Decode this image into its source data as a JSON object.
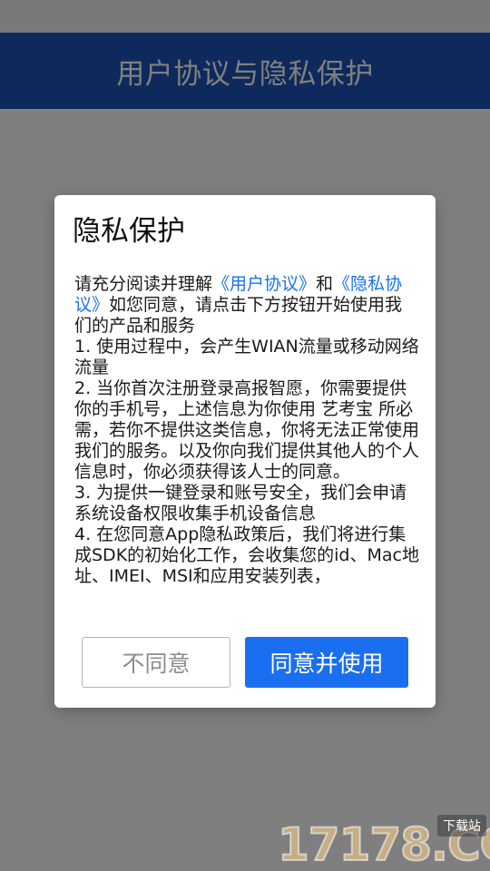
{
  "app_bar": {
    "title": "用户协议与隐私保护"
  },
  "dialog": {
    "title": "隐私保护",
    "intro_text": "请充分阅读并理解",
    "link_user_agreement": "《用户协议》",
    "intro_and": "和",
    "link_privacy_policy": "《隐私协议》",
    "intro_rest": "如您同意，请点击下方按钮开始使用我们的产品和服务",
    "items": [
      "1. 使用过程中，会产生WIAN流量或移动网络流量",
      "2. 当你首次注册登录高报智愿，你需要提供你的手机号，上述信息为你使用 艺考宝 所必需，若你不提供这类信息，你将无法正常使用我们的服务。以及你向我们提供其他人的个人信息时，你必须获得该人士的同意。",
      "3. 为提供一键登录和账号安全，我们会申请系统设备权限收集手机设备信息",
      "4. 在您同意App隐私政策后，我们将进行集成SDK的初始化工作，会收集您的id、Mac地址、IMEI、MSI和应用安装列表，"
    ],
    "disagree_label": "不同意",
    "agree_label": "同意并使用"
  },
  "watermark": {
    "logo_text": "17178.COM",
    "tag_text": "下载站"
  },
  "colors": {
    "app_bar": "#1c52b8",
    "link": "#1a73e8",
    "agree_button": "#1a6ef0",
    "overlay": "rgba(0,0,0,0.5)"
  }
}
